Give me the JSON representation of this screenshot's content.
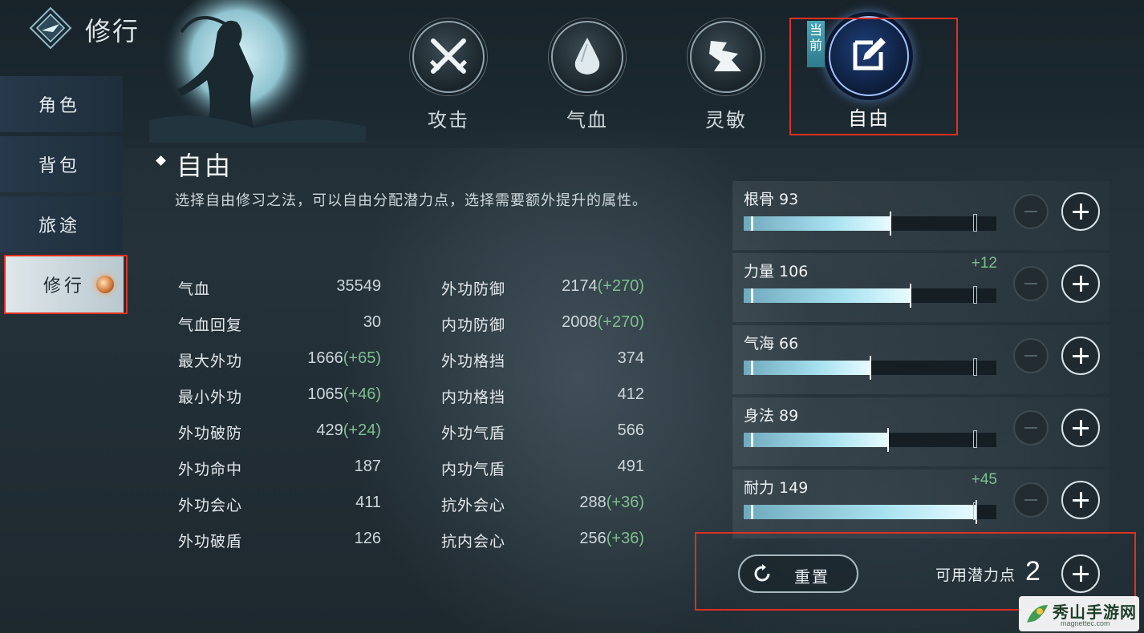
{
  "header": {
    "title": "修行"
  },
  "sidebar": {
    "items": [
      {
        "label": "角色"
      },
      {
        "label": "背包"
      },
      {
        "label": "旅途"
      },
      {
        "label": "修行"
      }
    ]
  },
  "tabs": [
    {
      "label": "攻击",
      "icon": "crossed-swords-icon"
    },
    {
      "label": "气血",
      "icon": "blood-drop-icon"
    },
    {
      "label": "灵敏",
      "icon": "agility-icon"
    },
    {
      "label": "自由",
      "icon": "edit-icon"
    }
  ],
  "current_tag": "当前",
  "section": {
    "title": "自由",
    "description": "选择自由修习之法，可以自由分配潜力点，选择需要额外提升的属性。"
  },
  "stats_left": [
    {
      "name": "气血",
      "value": "35549",
      "bonus": ""
    },
    {
      "name": "气血回复",
      "value": "30",
      "bonus": ""
    },
    {
      "name": "最大外功",
      "value": "1666",
      "bonus": "(+65)"
    },
    {
      "name": "最小外功",
      "value": "1065",
      "bonus": "(+46)"
    },
    {
      "name": "外功破防",
      "value": "429",
      "bonus": "(+24)"
    },
    {
      "name": "外功命中",
      "value": "187",
      "bonus": ""
    },
    {
      "name": "外功会心",
      "value": "411",
      "bonus": ""
    },
    {
      "name": "外功破盾",
      "value": "126",
      "bonus": ""
    }
  ],
  "stats_right": [
    {
      "name": "外功防御",
      "value": "2174",
      "bonus": "(+270)"
    },
    {
      "name": "内功防御",
      "value": "2008",
      "bonus": "(+270)"
    },
    {
      "name": "外功格挡",
      "value": "374",
      "bonus": ""
    },
    {
      "name": "内功格挡",
      "value": "412",
      "bonus": ""
    },
    {
      "name": "外功气盾",
      "value": "566",
      "bonus": ""
    },
    {
      "name": "内功气盾",
      "value": "491",
      "bonus": ""
    },
    {
      "name": "抗外会心",
      "value": "288",
      "bonus": "(+36)"
    },
    {
      "name": "抗内会心",
      "value": "256",
      "bonus": "(+36)"
    }
  ],
  "attributes": [
    {
      "label": "根骨 93",
      "bonus": "",
      "fill_fraction": 0.58
    },
    {
      "label": "力量 106",
      "bonus": "+12",
      "fill_fraction": 0.66
    },
    {
      "label": "气海 66",
      "bonus": "",
      "fill_fraction": 0.5
    },
    {
      "label": "身法 89",
      "bonus": "",
      "fill_fraction": 0.57
    },
    {
      "label": "耐力 149",
      "bonus": "+45",
      "fill_fraction": 0.92
    }
  ],
  "footer": {
    "reset_label": "重置",
    "points_label": "可用潜力点",
    "points_value": "2"
  },
  "watermark": {
    "text": "秀山手游网",
    "sub": "magnettec.com"
  }
}
